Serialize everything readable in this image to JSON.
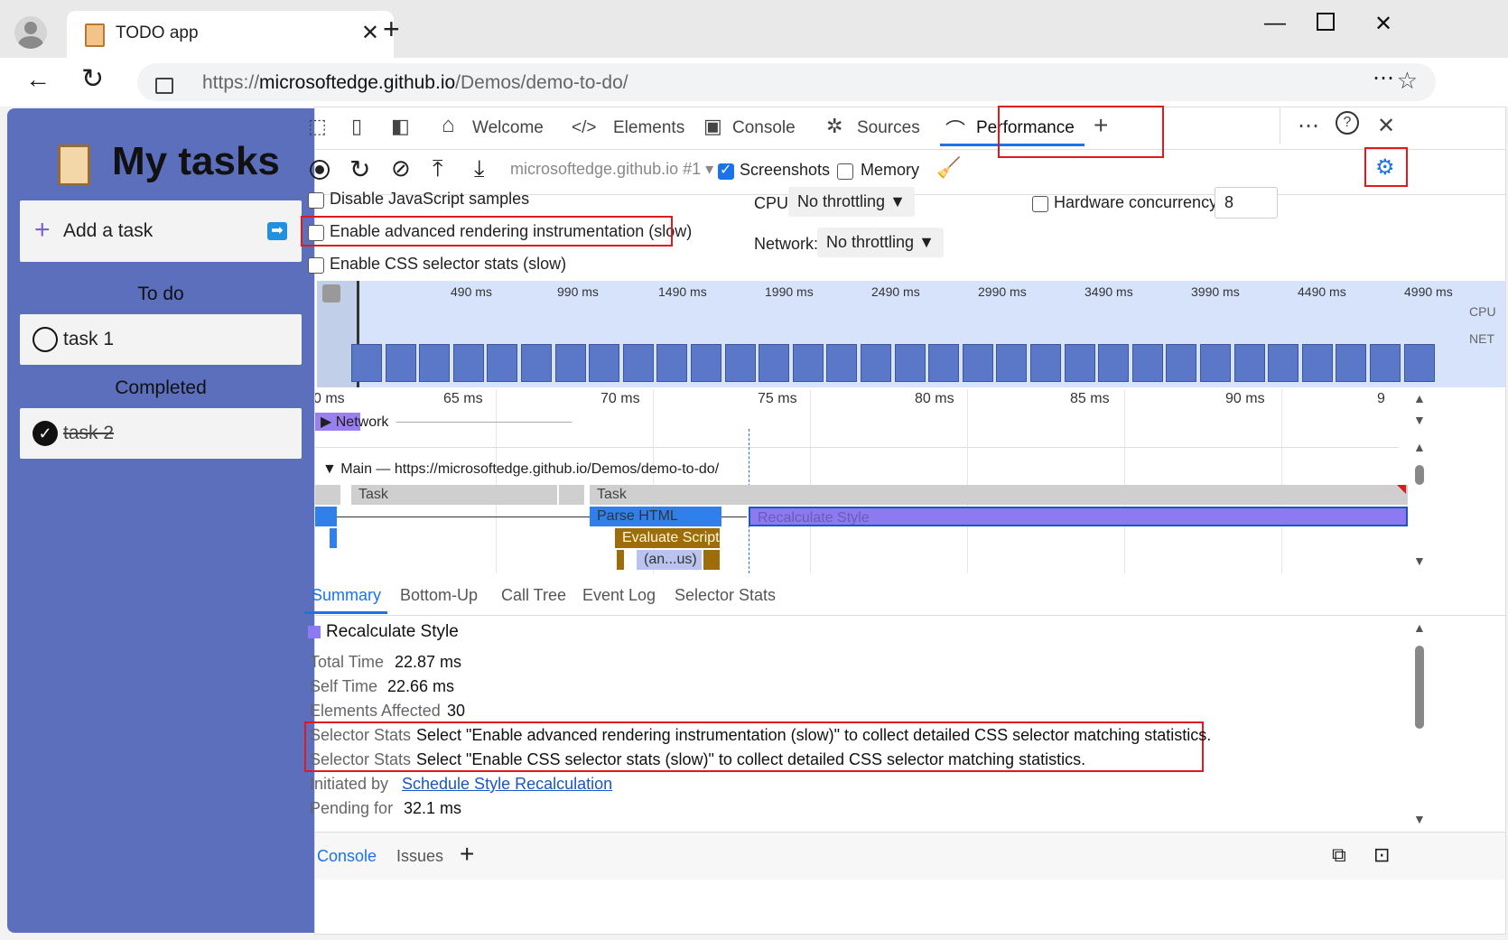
{
  "browser": {
    "tab_title": "TODO app",
    "url_prefix": "https://",
    "url_domain": "microsoftedge.github.io",
    "url_path": "/Demos/demo-to-do/"
  },
  "app": {
    "title": "My tasks",
    "add_task": "Add a task",
    "todo_heading": "To do",
    "todo_items": [
      "task 1"
    ],
    "completed_heading": "Completed",
    "completed_items": [
      "task 2"
    ]
  },
  "devtools": {
    "tabs": [
      "Welcome",
      "Elements",
      "Console",
      "Sources",
      "Performance"
    ],
    "active_tab": "Performance",
    "target": "microsoftedge.github.io #1",
    "screenshots_label": "Screenshots",
    "screenshots_checked": true,
    "memory_label": "Memory",
    "memory_checked": false,
    "settings": {
      "disable_js": "Disable JavaScript samples",
      "advanced_rendering": "Enable advanced rendering instrumentation (slow)",
      "css_selector_stats": "Enable CSS selector stats (slow)",
      "cpu_label": "CPU:",
      "cpu_value": "No throttling",
      "network_label": "Network:",
      "network_value": "No throttling",
      "hw_concurrency_label": "Hardware concurrency",
      "hw_concurrency_value": "8"
    },
    "overview_ticks": [
      "490 ms",
      "990 ms",
      "1490 ms",
      "1990 ms",
      "2490 ms",
      "2990 ms",
      "3490 ms",
      "3990 ms",
      "4490 ms",
      "4990 ms"
    ],
    "overview_lanes": [
      "CPU",
      "NET"
    ],
    "flame_ticks": [
      "0 ms",
      "65 ms",
      "70 ms",
      "75 ms",
      "80 ms",
      "85 ms",
      "90 ms",
      "9"
    ],
    "network_track": "Network",
    "main_track": "Main — https://microsoftedge.github.io/Demos/demo-to-do/",
    "bars": {
      "task1": "Task",
      "task2": "Task",
      "parse_html": "Parse HTML",
      "recalc": "Recalculate Style",
      "eval_script": "Evaluate Script",
      "anon": "(an...us)"
    },
    "bottom_tabs": [
      "Summary",
      "Bottom-Up",
      "Call Tree",
      "Event Log",
      "Selector Stats"
    ],
    "summary": {
      "title": "Recalculate Style",
      "rows": [
        {
          "k": "Total Time",
          "v": "22.87 ms"
        },
        {
          "k": "Self Time",
          "v": "22.66 ms"
        },
        {
          "k": "Elements Affected",
          "v": "30"
        },
        {
          "k": "Selector Stats",
          "v": "Select \"Enable advanced rendering instrumentation (slow)\" to collect detailed CSS selector matching statistics."
        },
        {
          "k": "Selector Stats",
          "v": "Select \"Enable CSS selector stats (slow)\" to collect detailed CSS selector matching statistics."
        },
        {
          "k": "Initiated by",
          "v": "Schedule Style Recalculation"
        },
        {
          "k": "Pending for",
          "v": "32.1 ms"
        }
      ]
    },
    "drawer_tabs": [
      "Console",
      "Issues"
    ]
  },
  "colors": {
    "accent": "#1a73e8",
    "highlight": "#e0191f",
    "app_bg": "#5b6fbd",
    "recalc": "#8d79f2",
    "script": "#9c6d08"
  }
}
